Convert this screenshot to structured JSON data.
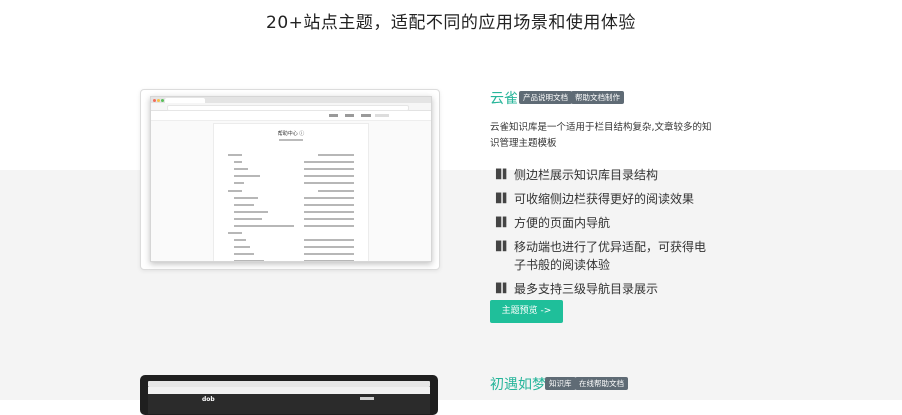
{
  "heading": "20+站点主题，适配不同的应用场景和使用体验",
  "themes": [
    {
      "name": "云雀",
      "tags": [
        "产品说明文档",
        "帮助文档制作"
      ],
      "description": "云雀知识库是一个适用于栏目结构复杂,文章较多的知识管理主题模板",
      "features": [
        "侧边栏展示知识库目录结构",
        "可收缩侧边栏获得更好的阅读效果",
        "方便的页面内导航",
        "移动端也进行了优异适配，可获得电子书般的阅读体验",
        "最多支持三级导航目录展示"
      ],
      "button_label": "主题预览 ->",
      "preview": {
        "doc_title": "帮助中心 ⓘ"
      }
    },
    {
      "name": "初遇如梦",
      "tags": [
        "知识库",
        "在线帮助文档"
      ],
      "preview": {
        "logo": "dob"
      }
    }
  ],
  "colors": {
    "accent": "#27b59a",
    "button": "#1fbf9a",
    "tag_bg": "#5f6b75",
    "band": "#f4f4f4"
  },
  "icons": {
    "feature_bullet": "book-icon"
  }
}
